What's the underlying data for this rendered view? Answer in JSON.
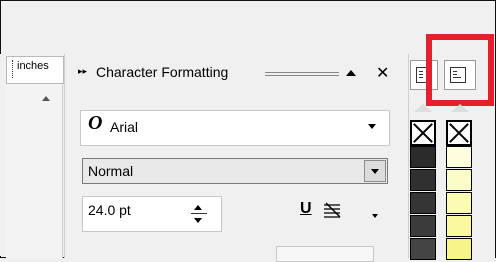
{
  "ruler": {
    "unit_label": "inches"
  },
  "docker": {
    "title": "Character Formatting",
    "font": {
      "name": "Arial",
      "icon": "opentype-o-icon"
    },
    "style": {
      "value": "Normal"
    },
    "size": {
      "value": "24.0 pt"
    }
  },
  "palette": {
    "dark": [
      "#2b2b2b",
      "#303030",
      "#353535",
      "#3b3b3b",
      "#444444"
    ],
    "light": [
      "#fdfde0",
      "#fcfcc8",
      "#fbfbb4",
      "#faf9a0",
      "#f7f58a"
    ]
  },
  "colors": {
    "highlight": "#e3202c"
  }
}
